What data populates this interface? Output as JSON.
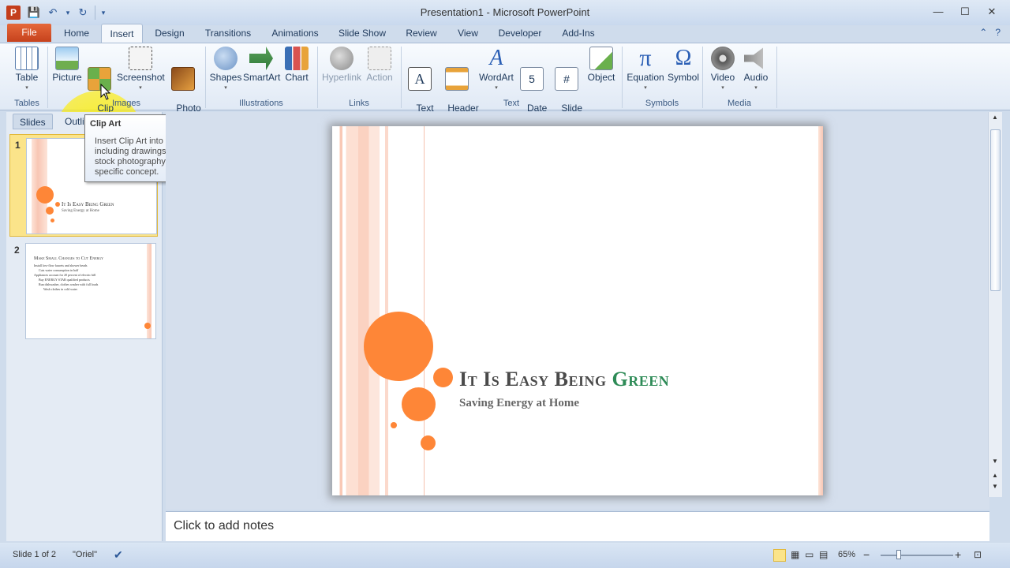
{
  "window": {
    "title": "Presentation1 - Microsoft PowerPoint",
    "app_icon_letter": "P",
    "controls": [
      "—",
      "☐",
      "✕"
    ]
  },
  "qat": {
    "save": "💾",
    "undo": "↶",
    "undo_dd": "▾",
    "redo": "↻",
    "customize": "▾"
  },
  "tabs": {
    "file": "File",
    "items": [
      "Home",
      "Insert",
      "Design",
      "Transitions",
      "Animations",
      "Slide Show",
      "Review",
      "View",
      "Developer",
      "Add-Ins"
    ],
    "active": "Insert",
    "help_minimize": "⌃",
    "help": "?"
  },
  "ribbon": {
    "buttons": {
      "table": "Table",
      "picture": "Picture",
      "clip_art": "Clip\nArt",
      "screenshot": "Screenshot",
      "photo_album": "Photo\nAlbum",
      "shapes": "Shapes",
      "smartart": "SmartArt",
      "chart": "Chart",
      "hyperlink": "Hyperlink",
      "action": "Action",
      "text_box": "Text\nBox",
      "header_footer": "Header\n& Footer",
      "wordart": "WordArt",
      "date_time": "Date\n& Time",
      "slide_number": "Slide\nNumber",
      "object": "Object",
      "equation": "Equation",
      "symbol": "Symbol",
      "video": "Video",
      "audio": "Audio"
    },
    "groups": {
      "tables": "Tables",
      "images": "Images",
      "illustrations": "Illustrations",
      "links": "Links",
      "text": "Text",
      "symbols": "Symbols",
      "media": "Media"
    }
  },
  "left_pane": {
    "tabs": [
      "Slides",
      "Outline"
    ],
    "slides": [
      {
        "number": "1",
        "title": "It Is Easy Being Green",
        "subtitle": "Saving Energy at Home"
      },
      {
        "number": "2",
        "title": "Make Small Changes to Cut Energy",
        "bullets": [
          "Install low-flow faucets and shower heads",
          "Cuts water consumption in half",
          "Appliances account for 20 percent of electric bill",
          "Buy ENERGY STAR qualified products",
          "Run dishwasher, clothes washer with full loads",
          "Wash clothes in cold water"
        ]
      }
    ]
  },
  "tooltip": {
    "title": "Clip Art",
    "body": "Insert Clip Art into the document, including drawings, movies, sounds, or stock photography to illustrate a specific concept."
  },
  "slide": {
    "title_part1": "It Is Easy Being ",
    "title_part2": "Green",
    "subtitle": "Saving Energy at Home",
    "colors": {
      "accent_orange": "#fe8637",
      "green": "#2e8b57",
      "stripe": "#f7c7b5"
    }
  },
  "notes": {
    "placeholder": "Click to add notes"
  },
  "status": {
    "slide_info": "Slide 1 of 2",
    "theme": "\"Oriel\"",
    "zoom": "65%",
    "zoom_minus": "−",
    "zoom_plus": "+"
  }
}
